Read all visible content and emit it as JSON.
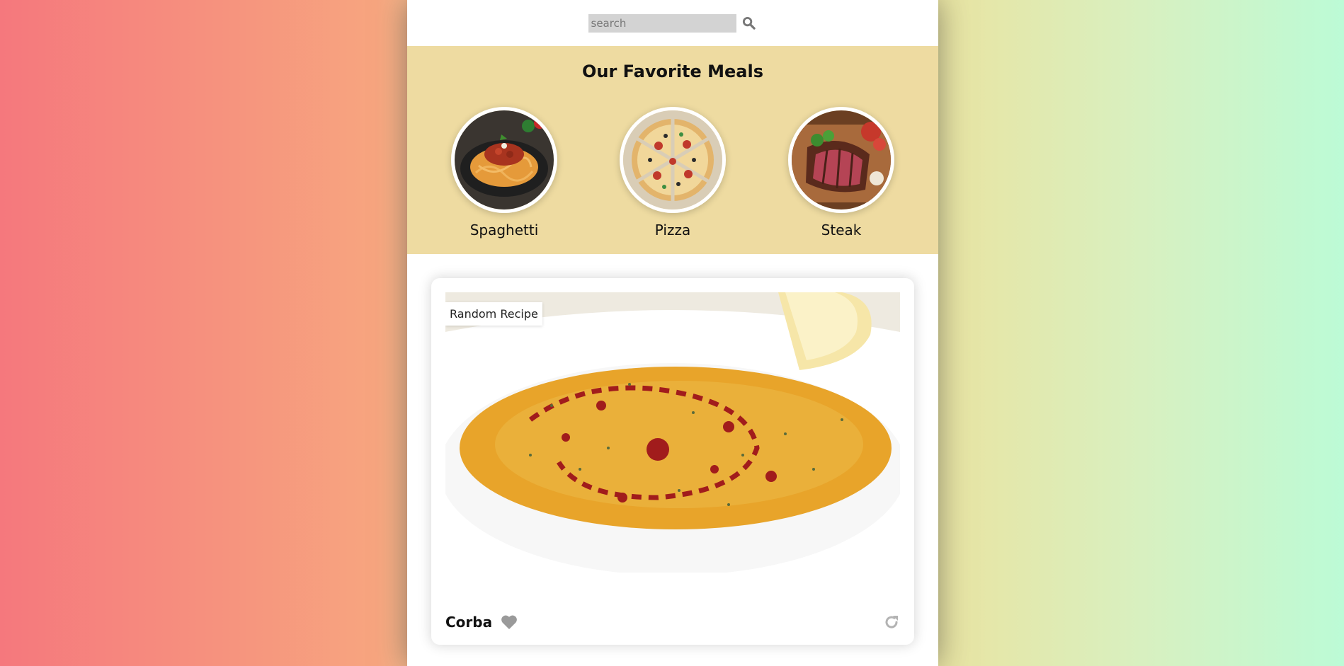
{
  "search": {
    "placeholder": "search",
    "value": ""
  },
  "favorites": {
    "title": "Our Favorite Meals",
    "items": [
      {
        "label": "Spaghetti"
      },
      {
        "label": "Pizza"
      },
      {
        "label": "Steak"
      }
    ]
  },
  "random_meal": {
    "badge": "Random Recipe",
    "name": "Corba"
  },
  "icons": {
    "search": "search-icon",
    "favorite": "heart-icon",
    "refresh": "refresh-icon"
  },
  "colors": {
    "favorites_bg": "#eedba1",
    "search_bg": "#d3d3d3",
    "icon_gray": "#999999"
  }
}
